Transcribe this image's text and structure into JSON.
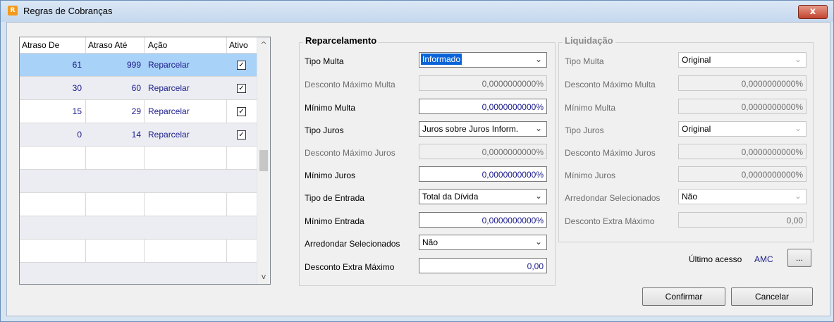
{
  "window": {
    "title": "Regras de Cobranças",
    "close_label": "x"
  },
  "grid": {
    "columns": [
      "Atraso De",
      "Atraso Até",
      "Ação",
      "Ativo"
    ],
    "rows": [
      {
        "de": "61",
        "ate": "999",
        "acao": "Reparcelar",
        "ativo": true,
        "selected": true
      },
      {
        "de": "30",
        "ate": "60",
        "acao": "Reparcelar",
        "ativo": true
      },
      {
        "de": "15",
        "ate": "29",
        "acao": "Reparcelar",
        "ativo": true
      },
      {
        "de": "0",
        "ate": "14",
        "acao": "Reparcelar",
        "ativo": true
      }
    ],
    "check_mark": "✓",
    "scroll_up": "^",
    "scroll_down": "v"
  },
  "reparcelamento": {
    "title": "Reparcelamento",
    "tipo_multa_label": "Tipo Multa",
    "tipo_multa": "Informado",
    "desc_max_multa_label": "Desconto Máximo Multa",
    "desc_max_multa": "0,0000000000%",
    "min_multa_label": "Mínimo Multa",
    "min_multa": "0,0000000000%",
    "tipo_juros_label": "Tipo Juros",
    "tipo_juros": "Juros sobre Juros Inform.",
    "desc_max_juros_label": "Desconto Máximo Juros",
    "desc_max_juros": "0,0000000000%",
    "min_juros_label": "Mínimo Juros",
    "min_juros": "0,0000000000%",
    "tipo_entrada_label": "Tipo de Entrada",
    "tipo_entrada": "Total da Dívida",
    "min_entrada_label": "Mínimo Entrada",
    "min_entrada": "0,0000000000%",
    "arredondar_label": "Arredondar Selecionados",
    "arredondar": "Não",
    "desc_extra_label": "Desconto Extra Máximo",
    "desc_extra": "0,00"
  },
  "liquidacao": {
    "title": "Liquidação",
    "tipo_multa_label": "Tipo Multa",
    "tipo_multa": "Original",
    "desc_max_multa_label": "Desconto Máximo Multa",
    "desc_max_multa": "0,0000000000%",
    "min_multa_label": "Mínimo Multa",
    "min_multa": "0,0000000000%",
    "tipo_juros_label": "Tipo Juros",
    "tipo_juros": "Original",
    "desc_max_juros_label": "Desconto Máximo Juros",
    "desc_max_juros": "0,0000000000%",
    "min_juros_label": "Mínimo Juros",
    "min_juros": "0,0000000000%",
    "arredondar_label": "Arredondar Selecionados",
    "arredondar": "Não",
    "desc_extra_label": "Desconto Extra Máximo",
    "desc_extra": "0,00"
  },
  "footer": {
    "ultimo_acesso_label": "Último acesso",
    "ultimo_acesso_user": "AMC",
    "ellipsis_label": "...",
    "confirmar_label": "Confirmar",
    "cancelar_label": "Cancelar"
  },
  "colors": {
    "selected_row": "#a9d2f8",
    "alt_row": "#ebedf2",
    "value_text": "#1a1a8c",
    "accent": "#0a64d8"
  },
  "icons": {
    "app": "app-icon",
    "close": "close-icon",
    "dropdown": "chevron-down-icon"
  }
}
